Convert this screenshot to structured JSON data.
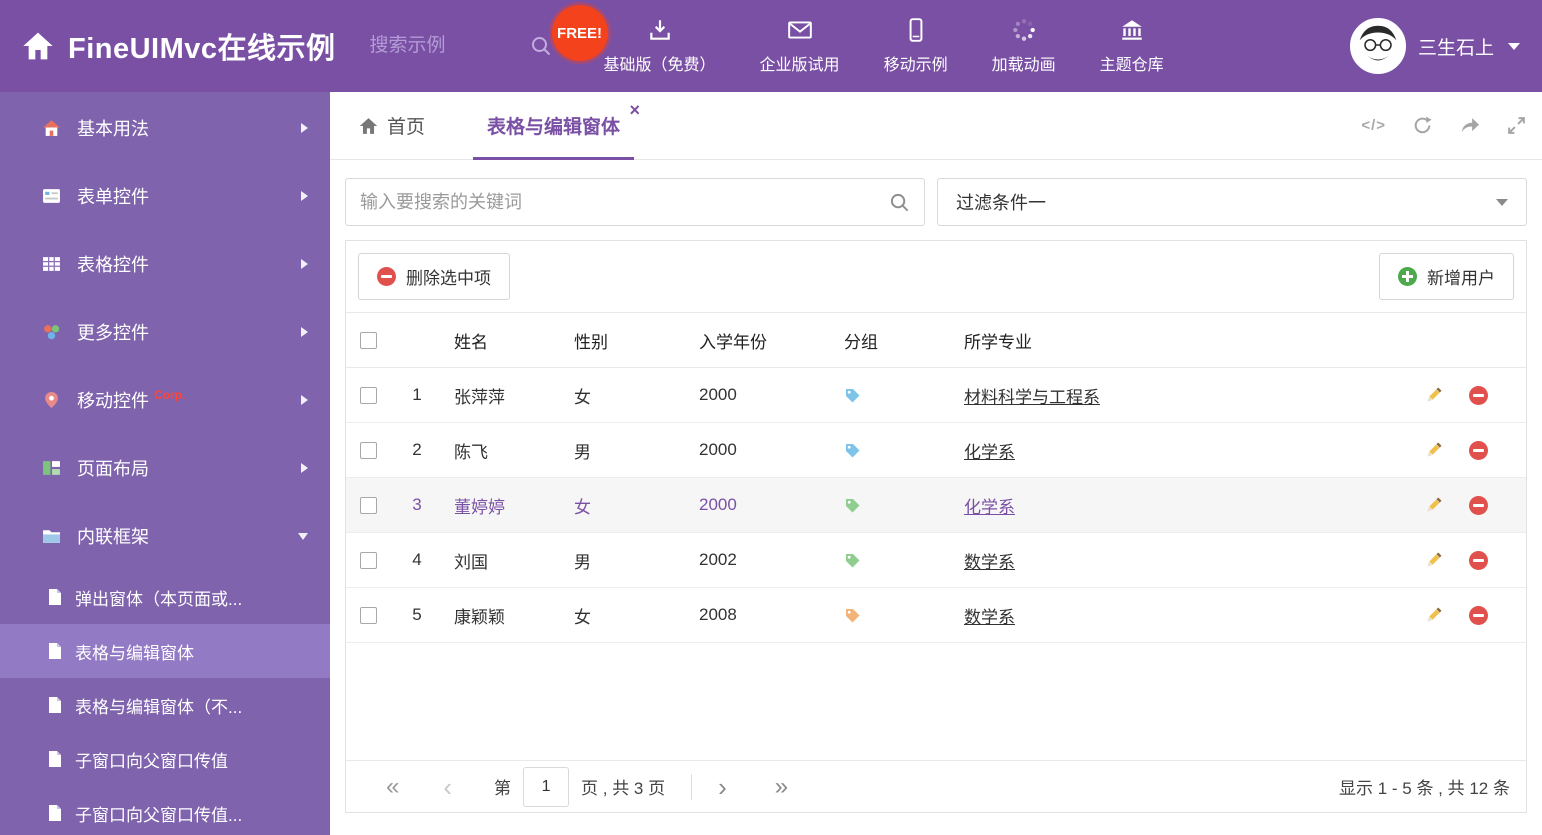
{
  "header": {
    "title": "FineUIMvc在线示例",
    "search_placeholder": "搜索示例",
    "free_badge": "FREE!",
    "nav_items": [
      {
        "label": "基础版（免费）"
      },
      {
        "label": "企业版试用"
      },
      {
        "label": "移动示例"
      },
      {
        "label": "加载动画"
      },
      {
        "label": "主题仓库"
      }
    ],
    "username": "三生石上"
  },
  "sidebar": {
    "items": [
      {
        "label": "基本用法"
      },
      {
        "label": "表单控件"
      },
      {
        "label": "表格控件"
      },
      {
        "label": "更多控件"
      },
      {
        "label": "移动控件",
        "badge": "Corp."
      },
      {
        "label": "页面布局"
      },
      {
        "label": "内联框架"
      }
    ],
    "subitems": [
      {
        "label": "弹出窗体（本页面或..."
      },
      {
        "label": "表格与编辑窗体"
      },
      {
        "label": "表格与编辑窗体（不..."
      },
      {
        "label": "子窗口向父窗口传值"
      },
      {
        "label": "子窗口向父窗口传值..."
      }
    ]
  },
  "tabbar": {
    "tabs": [
      {
        "label": "首页"
      },
      {
        "label": "表格与编辑窗体"
      }
    ]
  },
  "filters": {
    "search_placeholder": "输入要搜索的关键词",
    "filter_value": "过滤条件一"
  },
  "toolbar": {
    "delete_label": "删除选中项",
    "add_label": "新增用户"
  },
  "table": {
    "columns": {
      "name": "姓名",
      "gender": "性别",
      "year": "入学年份",
      "group": "分组",
      "major": "所学专业"
    },
    "rows": [
      {
        "num": "1",
        "name": "张萍萍",
        "gender": "女",
        "year": "2000",
        "tag_color": "#7ec4e8",
        "major": "材料科学与工程系"
      },
      {
        "num": "2",
        "name": "陈飞",
        "gender": "男",
        "year": "2000",
        "tag_color": "#7ec4e8",
        "major": "化学系"
      },
      {
        "num": "3",
        "name": "董婷婷",
        "gender": "女",
        "year": "2000",
        "tag_color": "#8fce8f",
        "major": "化学系"
      },
      {
        "num": "4",
        "name": "刘国",
        "gender": "男",
        "year": "2002",
        "tag_color": "#8fce8f",
        "major": "数学系"
      },
      {
        "num": "5",
        "name": "康颖颖",
        "gender": "女",
        "year": "2008",
        "tag_color": "#f2b378",
        "major": "数学系"
      }
    ]
  },
  "pagination": {
    "prefix": "第",
    "page": "1",
    "suffix": "页 , 共 3 页",
    "summary": "显示 1 - 5 条 , 共 12 条"
  },
  "colors": {
    "header_purple": "#7a50a5",
    "sidebar_purple": "#7f63ad",
    "sidebar_active_purple": "#937ac4",
    "accent_purple": "#7a50a5",
    "free_badge_red": "#f4421c",
    "delete_red": "#e0514d",
    "add_green": "#4ca94c",
    "edit_yellow": "#f0c04a"
  }
}
